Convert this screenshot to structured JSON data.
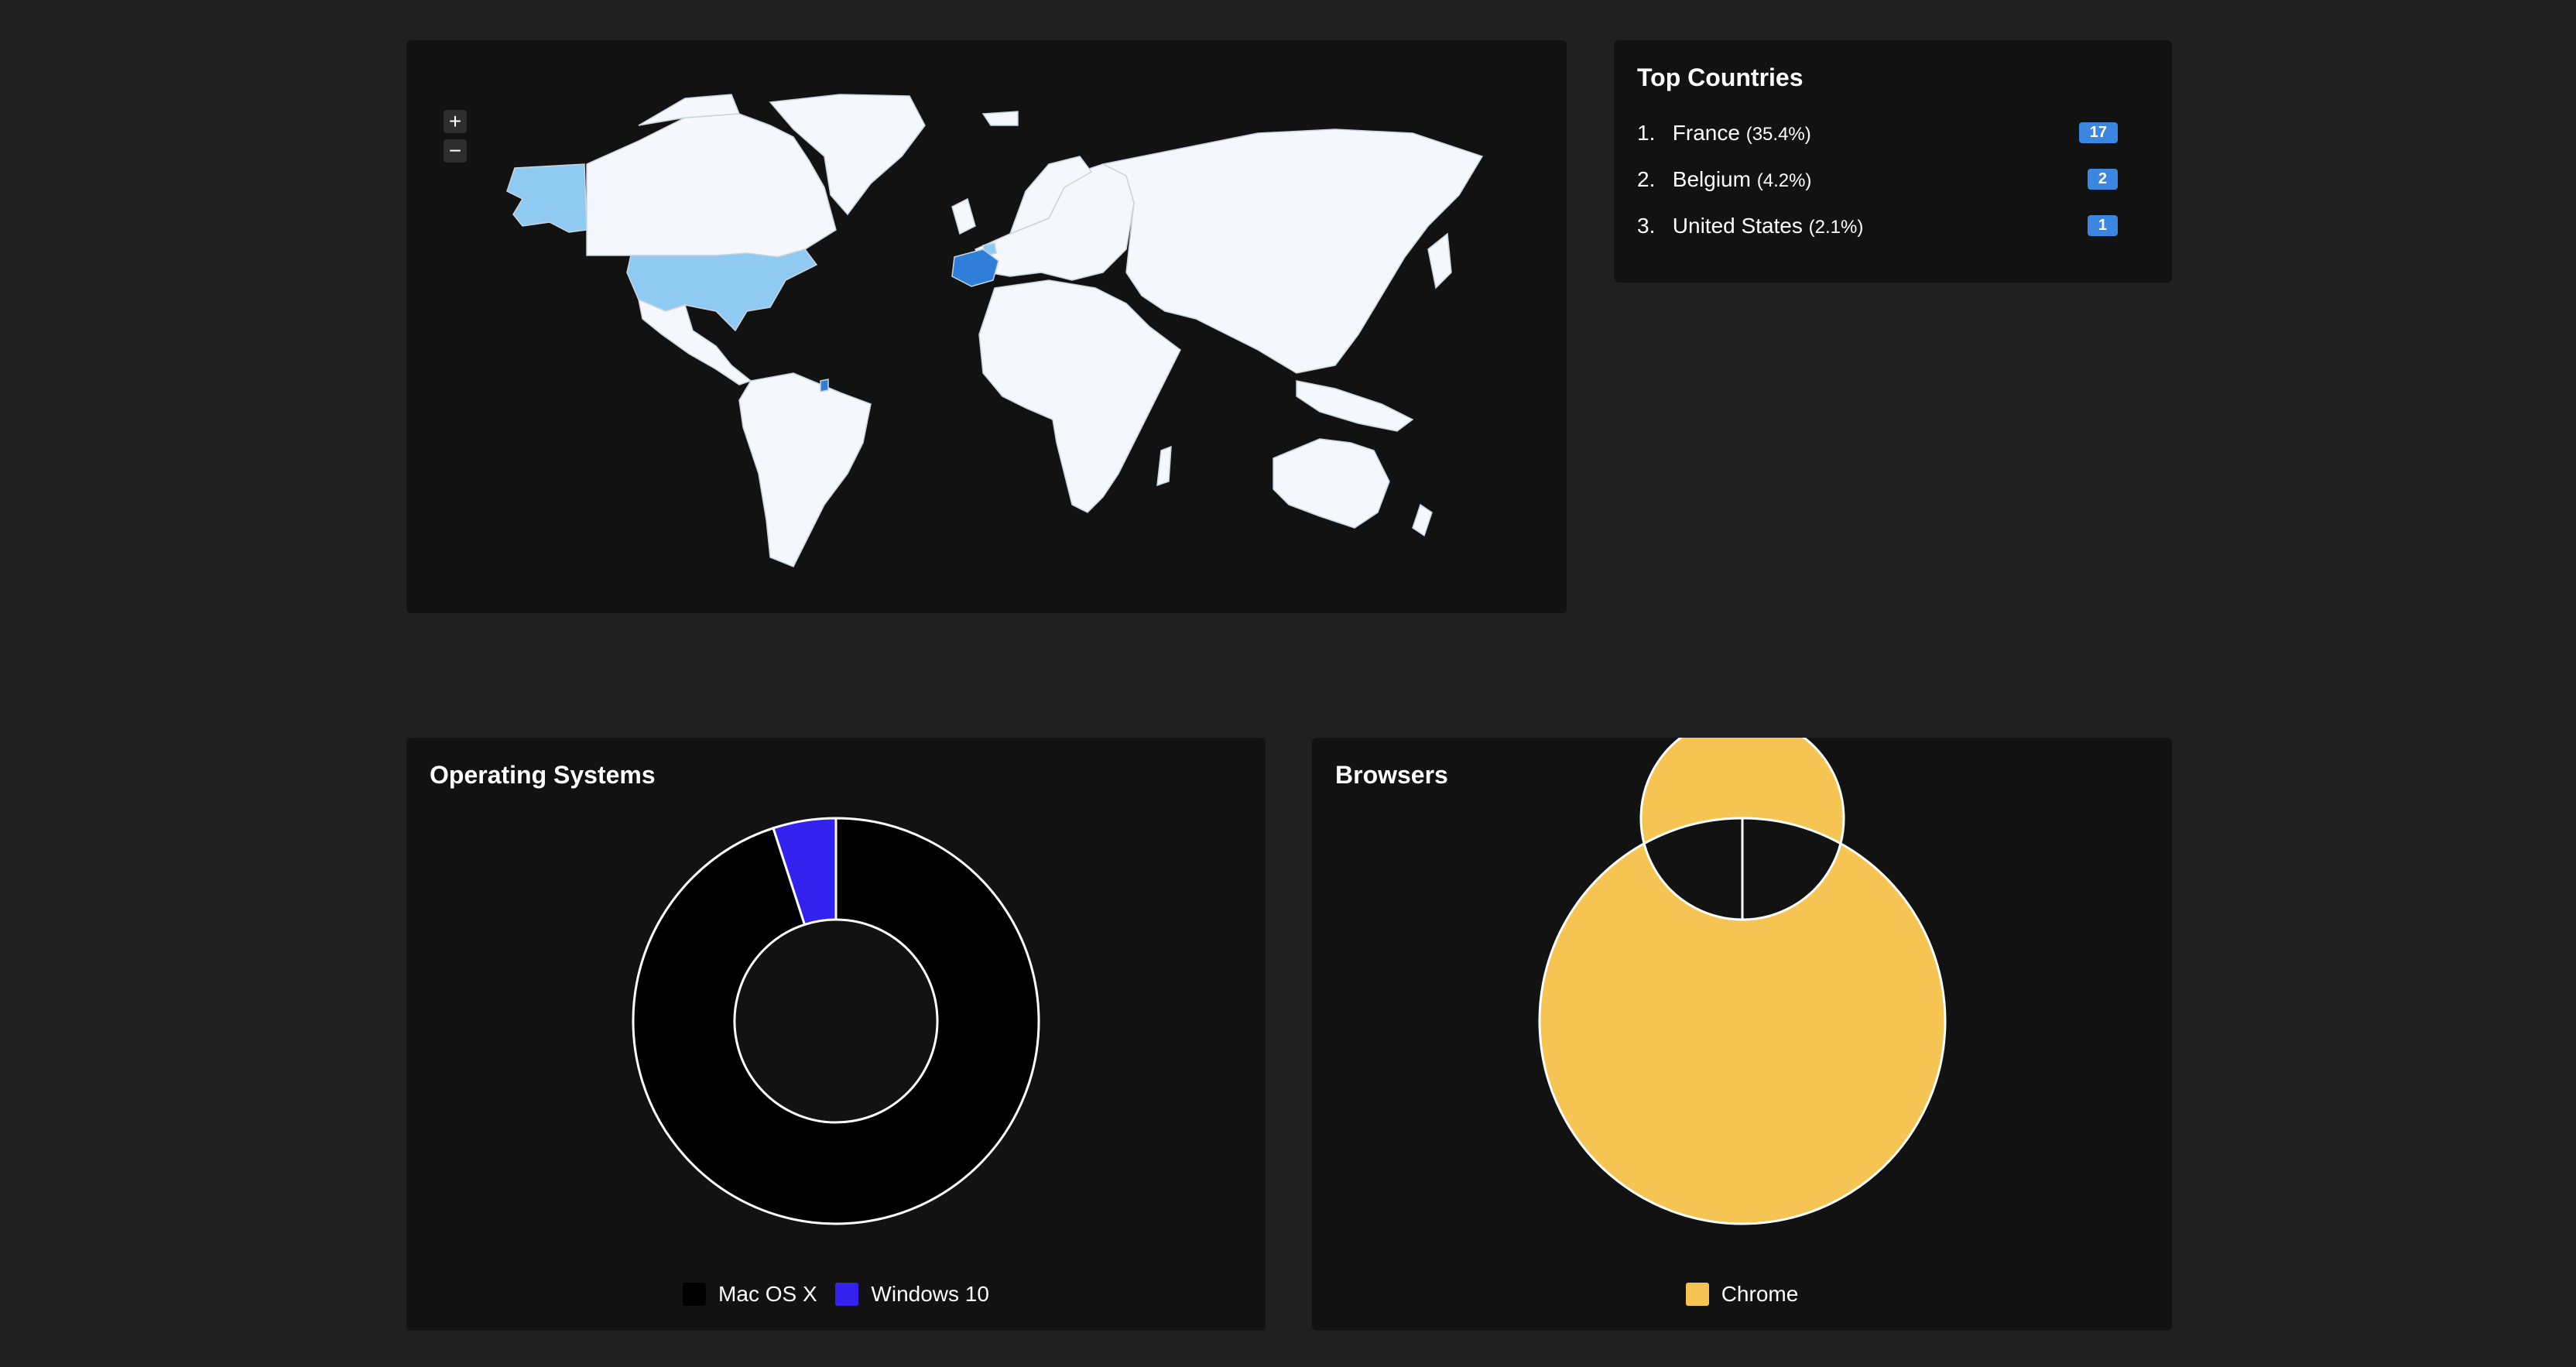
{
  "map": {
    "zoom_in_label": "+",
    "zoom_out_label": "−",
    "highlighted_countries": [
      {
        "name": "France",
        "color": "#2f7fd8"
      },
      {
        "name": "Belgium",
        "color": "#8ecaf2"
      },
      {
        "name": "United States",
        "color": "#8ecaf2"
      }
    ],
    "colors": {
      "land": "#f4f7fb",
      "border": "#c8d4de",
      "background": "#121212"
    }
  },
  "top_countries": {
    "title": "Top Countries",
    "items": [
      {
        "rank": "1.",
        "name": "France",
        "percent": "(35.4%)",
        "count": "17"
      },
      {
        "rank": "2.",
        "name": "Belgium",
        "percent": "(4.2%)",
        "count": "2"
      },
      {
        "rank": "3.",
        "name": "United States",
        "percent": "(2.1%)",
        "count": "1"
      }
    ],
    "badge_color": "#3a86e0"
  },
  "chart_data": [
    {
      "type": "pie",
      "title": "Operating Systems",
      "categories": [
        "Mac OS X",
        "Windows 10"
      ],
      "values": [
        95,
        5
      ],
      "colors": [
        "#000000",
        "#3322ee"
      ],
      "legend": "bottom"
    },
    {
      "type": "pie",
      "title": "Browsers",
      "categories": [
        "Chrome"
      ],
      "values": [
        100
      ],
      "colors": [
        "#f6c453"
      ],
      "legend": "bottom"
    }
  ]
}
